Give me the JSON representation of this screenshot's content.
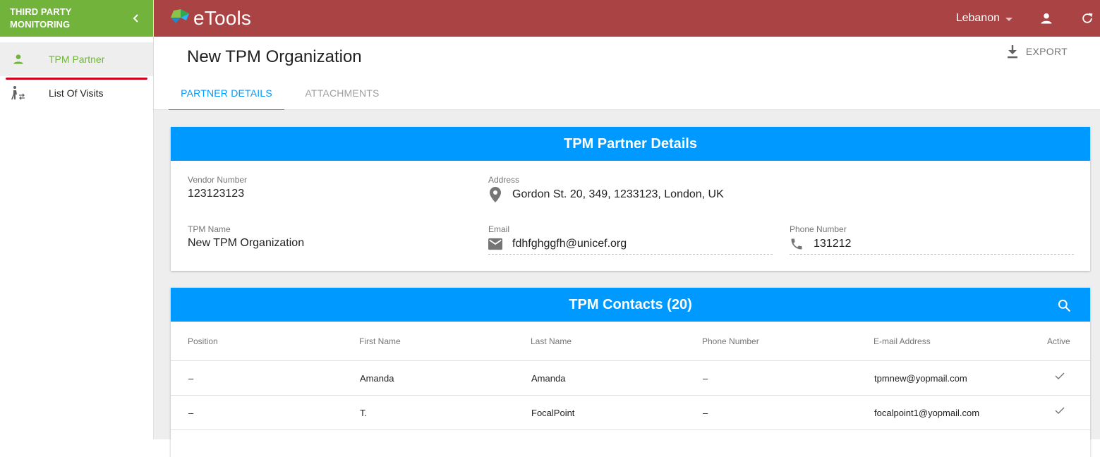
{
  "sidebar": {
    "title": "THIRD PARTY MONITORING",
    "items": [
      {
        "label": "TPM Partner",
        "icon": "person-icon",
        "active": true
      },
      {
        "label": "List Of Visits",
        "icon": "visits-icon",
        "active": false
      }
    ]
  },
  "topbar": {
    "brand": "eTools",
    "country": "Lebanon",
    "colors": {
      "bar": "#aa4444",
      "sidebar_header": "#72b43b",
      "accent": "#0099ff"
    }
  },
  "page": {
    "title": "New TPM Organization",
    "export_label": "EXPORT",
    "tabs": [
      {
        "label": "PARTNER DETAILS",
        "active": true
      },
      {
        "label": "ATTACHMENTS",
        "active": false
      }
    ]
  },
  "details": {
    "header": "TPM Partner Details",
    "vendor_number_label": "Vendor Number",
    "vendor_number": "123123123",
    "address_label": "Address",
    "address": "Gordon St. 20, 349, 1233123, London, UK",
    "tpm_name_label": "TPM Name",
    "tpm_name": "New TPM Organization",
    "email_label": "Email",
    "email": "fdhfghggfh@unicef.org",
    "phone_label": "Phone Number",
    "phone": "131212"
  },
  "contacts": {
    "header": "TPM Contacts (20)",
    "columns": [
      "Position",
      "First Name",
      "Last Name",
      "Phone Number",
      "E-mail Address",
      "Active"
    ],
    "rows": [
      {
        "position": "–",
        "first_name": "Amanda",
        "last_name": "Amanda",
        "phone": "–",
        "email": "tpmnew@yopmail.com",
        "active": true
      },
      {
        "position": "–",
        "first_name": "T.",
        "last_name": "FocalPoint",
        "phone": "–",
        "email": "focalpoint1@yopmail.com",
        "active": true
      }
    ]
  }
}
